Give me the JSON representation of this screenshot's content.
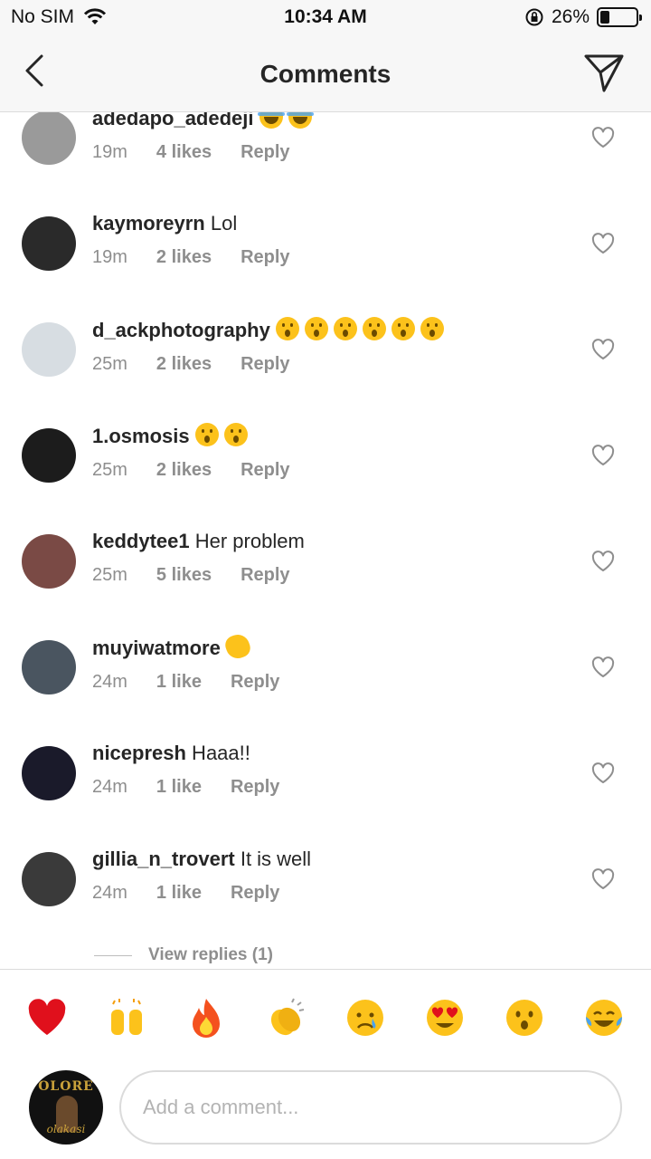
{
  "status_bar": {
    "carrier": "No SIM",
    "time": "10:34 AM",
    "battery": "26%",
    "battery_level": 0.26
  },
  "header": {
    "title": "Comments"
  },
  "comments": [
    {
      "username": "adedapo_adedeji",
      "text": "",
      "emoji": [
        "face-with-tears-of-joy",
        "face-with-tears-of-joy"
      ],
      "time": "19m",
      "likes": "4 likes",
      "reply": "Reply",
      "avatar_color": "#9a9a9a"
    },
    {
      "username": "kaymoreyrn",
      "text": "Lol",
      "emoji": [],
      "time": "19m",
      "likes": "2 likes",
      "reply": "Reply",
      "avatar_color": "#2a2a2a"
    },
    {
      "username": "d_ackphotography",
      "text": "",
      "emoji": [
        "hushed-face",
        "hushed-face",
        "hushed-face",
        "hushed-face",
        "hushed-face",
        "hushed-face"
      ],
      "time": "25m",
      "likes": "2 likes",
      "reply": "Reply",
      "avatar_color": "#d7dde2"
    },
    {
      "username": "1.osmosis",
      "text": "",
      "emoji": [
        "hushed-face",
        "hushed-face"
      ],
      "time": "25m",
      "likes": "2 likes",
      "reply": "Reply",
      "avatar_color": "#1c1c1c"
    },
    {
      "username": "keddytee1",
      "text": "Her problem",
      "emoji": [],
      "time": "25m",
      "likes": "5 likes",
      "reply": "Reply",
      "avatar_color": "#7a4a45"
    },
    {
      "username": "muyiwatmore",
      "text": "",
      "emoji": [
        "clapping-hands"
      ],
      "time": "24m",
      "likes": "1 like",
      "reply": "Reply",
      "avatar_color": "#4a5560"
    },
    {
      "username": "nicepresh",
      "text": "Haaa!!",
      "emoji": [],
      "time": "24m",
      "likes": "1 like",
      "reply": "Reply",
      "avatar_color": "#1a1a2a"
    },
    {
      "username": "gillia_n_trovert",
      "text": "It is well",
      "emoji": [],
      "time": "24m",
      "likes": "1 like",
      "reply": "Reply",
      "avatar_color": "#3a3a3a"
    }
  ],
  "view_replies": "View replies (1)",
  "reactions": [
    "red-heart",
    "raising-hands",
    "fire",
    "clapping-hands",
    "crying-face",
    "heart-eyes",
    "hushed-face",
    "face-with-tears-of-joy"
  ],
  "composer": {
    "placeholder": "Add a comment...",
    "avatar_logo": "OLORE",
    "avatar_script": "olakasi"
  }
}
